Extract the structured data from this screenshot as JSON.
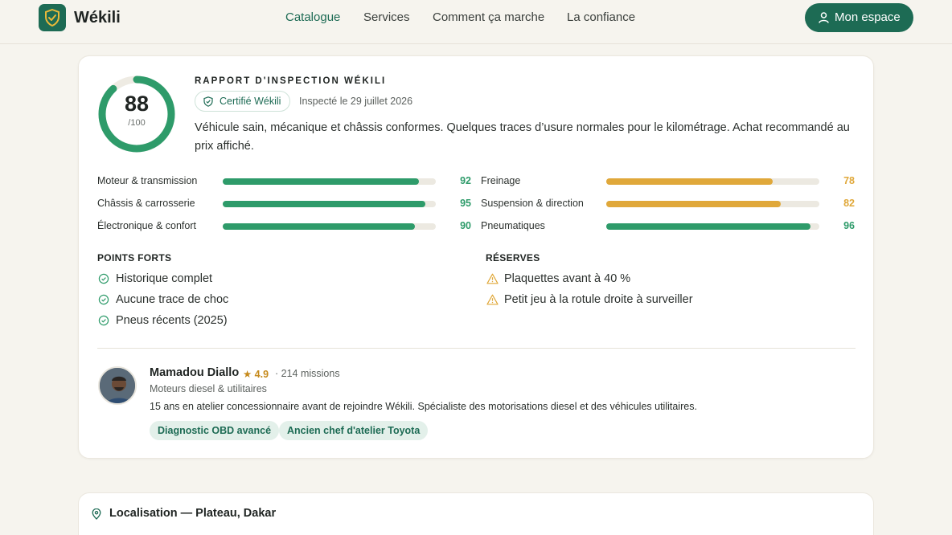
{
  "header": {
    "brand": "Wékili",
    "nav": [
      "Catalogue",
      "Services",
      "Comment ça marche",
      "La confiance"
    ],
    "account_button": "Mon espace"
  },
  "report": {
    "score": "88",
    "score_max": "/100",
    "score_fraction": 0.88,
    "eyebrow": "RAPPORT D'INSPECTION WÉKILI",
    "badge": "Certifié Wékili",
    "inspected": "Inspecté le 29 juillet 2026",
    "summary": "Véhicule sain, mécanique et châssis conformes. Quelques traces d’usure normales pour le kilométrage. Achat recommandé au prix affiché.",
    "criteria": [
      {
        "label": "Moteur & transmission",
        "value": "92",
        "score": 92,
        "color": "#2e9b6a"
      },
      {
        "label": "Freinage",
        "value": "78",
        "score": 78,
        "color": "#e0a83a"
      },
      {
        "label": "Châssis & carrosserie",
        "value": "95",
        "score": 95,
        "color": "#2e9b6a"
      },
      {
        "label": "Suspension & direction",
        "value": "82",
        "score": 82,
        "color": "#e0a83a"
      },
      {
        "label": "Électronique & confort",
        "value": "90",
        "score": 90,
        "color": "#2e9b6a"
      },
      {
        "label": "Pneumatiques",
        "value": "96",
        "score": 96,
        "color": "#2e9b6a"
      }
    ],
    "strengths_title": "POINTS FORTS",
    "strengths": [
      "Historique complet",
      "Aucune trace de choc",
      "Pneus récents (2025)"
    ],
    "reserves_title": "RÉSERVES",
    "reserves": [
      "Plaquettes avant à 40 %",
      "Petit jeu à la rotule droite à surveiller"
    ]
  },
  "inspector": {
    "name": "Mamadou Diallo",
    "rating": "★ 4.9",
    "missions": "· 214 missions",
    "specialty": "Moteurs diesel & utilitaires",
    "bio": "15 ans en atelier concessionnaire avant de rejoindre Wékili. Spécialiste des motorisations diesel et des véhicules utilitaires.",
    "tags": [
      "Diagnostic OBD avancé",
      "Ancien chef d'atelier Toyota"
    ]
  },
  "location": {
    "title": "Localisation — Plateau, Dakar"
  },
  "colors": {
    "brand": "#1d6b54",
    "good": "#2e9b6a",
    "warn": "#e0a83a"
  }
}
